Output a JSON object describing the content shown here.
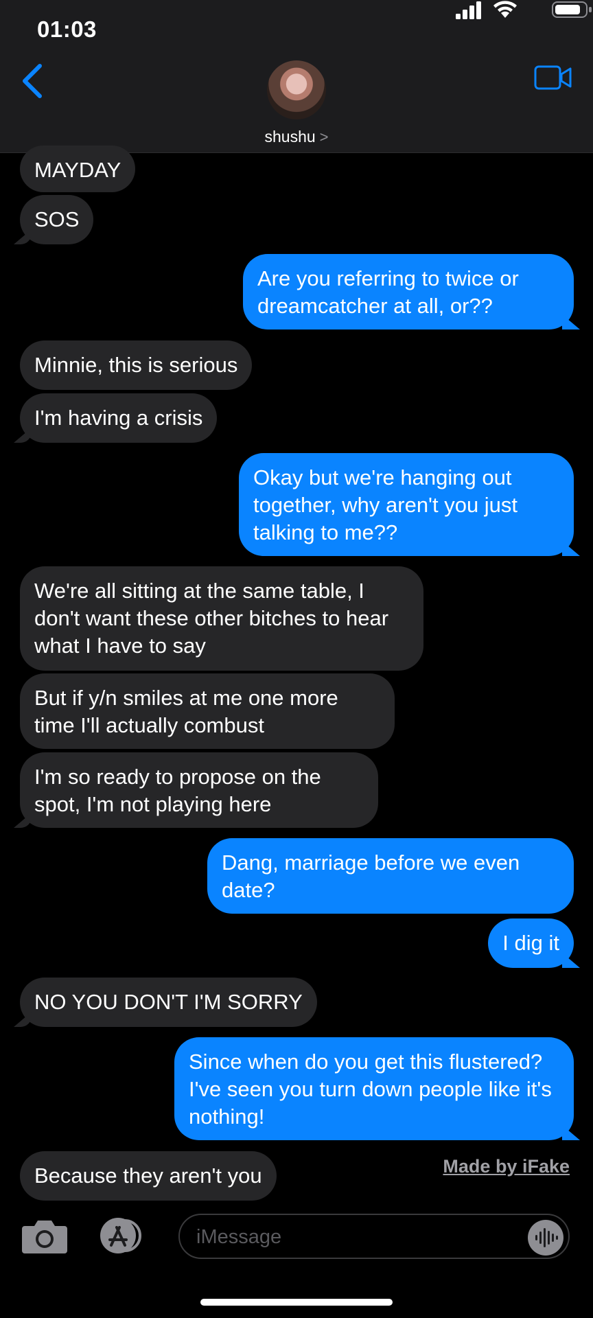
{
  "status_bar": {
    "time": "01:03"
  },
  "header": {
    "contact_name": "shushu",
    "chevron": ">"
  },
  "messages": [
    {
      "side": "in",
      "text": "MAYDAY"
    },
    {
      "side": "in",
      "text": "SOS"
    },
    {
      "side": "out",
      "text": "Are you referring to twice or dreamcatcher at all, or??"
    },
    {
      "side": "in",
      "text": "Minnie, this is serious"
    },
    {
      "side": "in",
      "text": "I'm having a crisis"
    },
    {
      "side": "out",
      "text": "Okay but we're hanging out together, why aren't you just talking to me??"
    },
    {
      "side": "in",
      "text": "We're all sitting at the same table, I don't want these other bitches to hear what I have to say"
    },
    {
      "side": "in",
      "text": "But if y/n smiles at me one more time I'll actually combust"
    },
    {
      "side": "in",
      "text": "I'm so ready to propose on the spot, I'm not playing here"
    },
    {
      "side": "out",
      "text": "Dang, marriage before we even date?"
    },
    {
      "side": "out",
      "text": "I dig it"
    },
    {
      "side": "in",
      "text": "NO YOU DON'T I'M SORRY"
    },
    {
      "side": "out",
      "text": "Since when do you get this flustered? I've seen you turn down people like it's nothing!"
    },
    {
      "side": "in",
      "text": "Because they aren't you"
    }
  ],
  "watermark": "Made by iFake",
  "input": {
    "placeholder": "iMessage"
  },
  "colors": {
    "accent": "#0a84ff",
    "incoming_bubble": "#262628",
    "header_bg": "#1c1c1e"
  },
  "icons": [
    "back-icon",
    "video-call-icon",
    "camera-icon",
    "app-store-icon",
    "audio-message-icon"
  ]
}
